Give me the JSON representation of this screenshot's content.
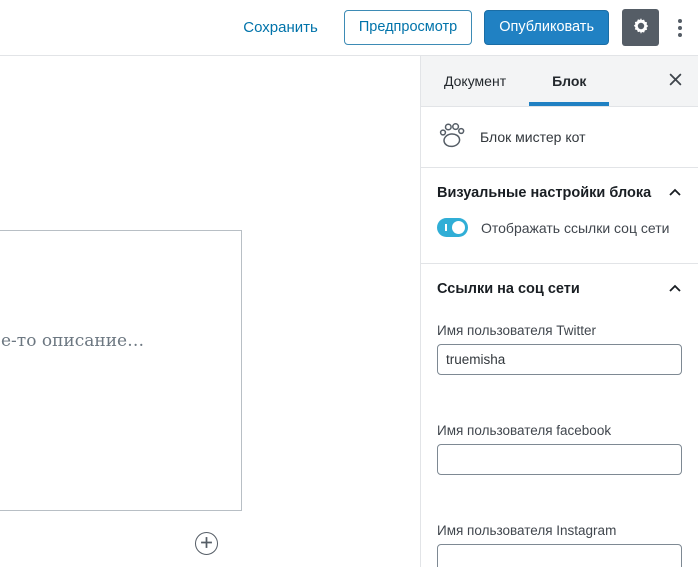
{
  "topbar": {
    "save_label": "Сохранить",
    "preview_label": "Предпросмотр",
    "publish_label": "Опубликовать"
  },
  "sidebar": {
    "tabs": [
      {
        "label": "Документ",
        "active": false
      },
      {
        "label": "Блок",
        "active": true
      }
    ],
    "block_card": {
      "icon": "paw-icon",
      "title": "Блок мистер кот"
    },
    "panels": [
      {
        "title": "Визуальные настройки блока",
        "collapsed": false,
        "toggle": {
          "state": "on",
          "label": "Отображать ссылки соц сети"
        }
      },
      {
        "title": "Ссылки на соц сети",
        "collapsed": false,
        "fields": [
          {
            "label": "Имя пользователя Twitter",
            "value": "truemisha"
          },
          {
            "label": "Имя пользователя facebook",
            "value": ""
          },
          {
            "label": "Имя пользователя Instagram",
            "value": ""
          }
        ]
      }
    ]
  },
  "content": {
    "description_visible_text": "е-то описание…",
    "inserter_glyph": "⊕"
  },
  "icons": [
    "gear-icon",
    "more-vertical-icon",
    "close-icon",
    "paw-icon",
    "chevron-up-icon",
    "plus-circle-icon"
  ],
  "colors": {
    "accent_blue": "#2081c3",
    "link_blue": "#0073aa",
    "toggle_blue": "#30aed6",
    "dark_gray": "#555d66",
    "border_gray": "#e2e4e7"
  }
}
